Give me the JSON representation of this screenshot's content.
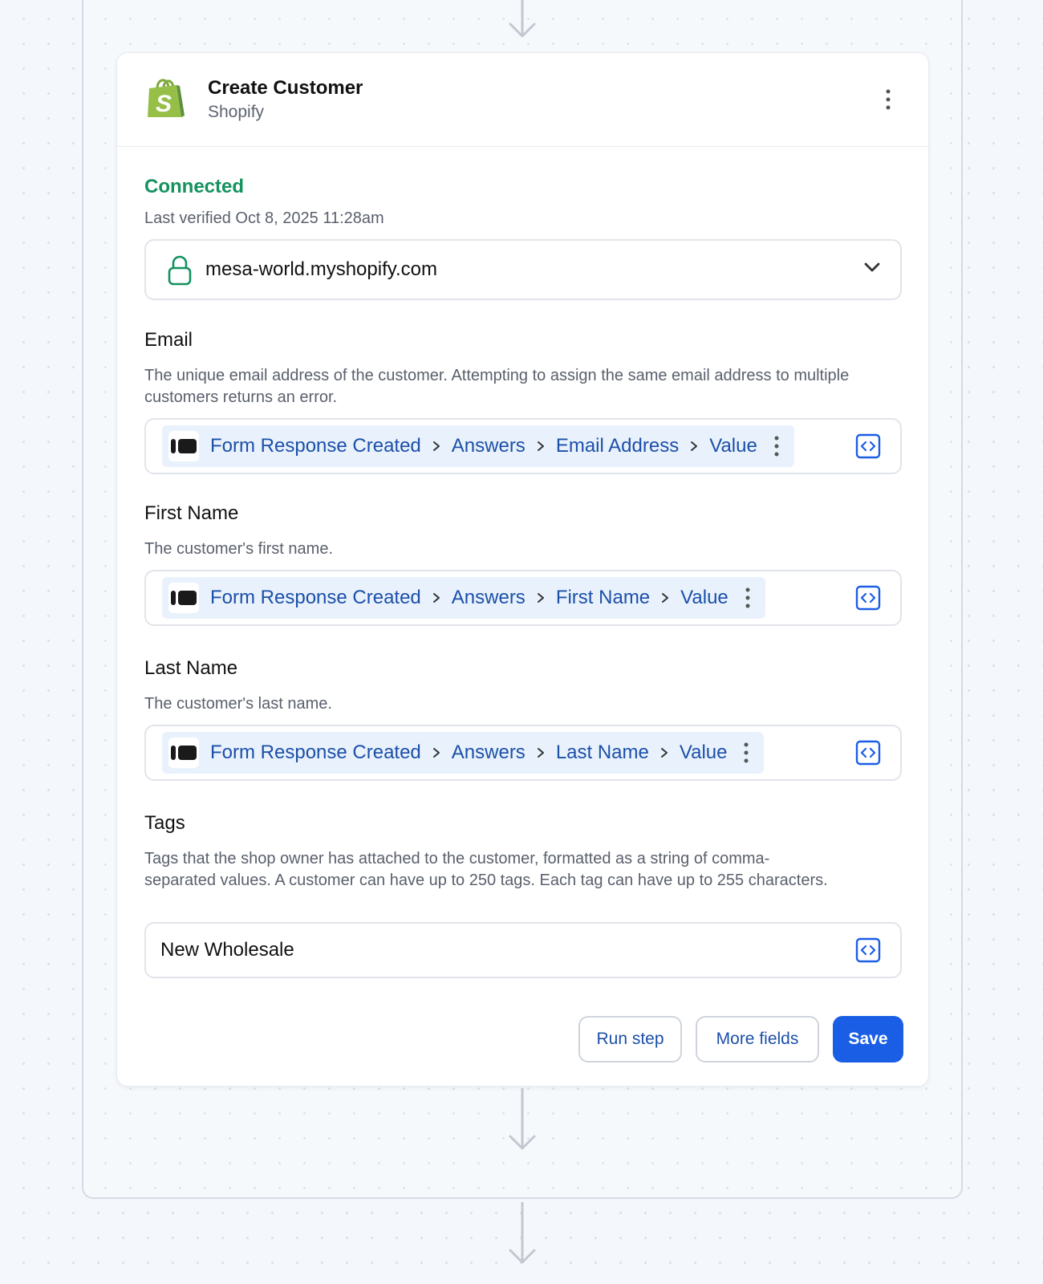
{
  "step": {
    "title": "Create Customer",
    "app": "Shopify",
    "logo_icon": "shopify-bag-icon",
    "brand_color": "#95bf47"
  },
  "connection": {
    "status": "Connected",
    "status_color": "#13925f",
    "last_verified": "Last verified Oct 8, 2025 11:28am",
    "account": "mesa-world.myshopify.com",
    "icons": [
      "lock-icon",
      "chevron-down-icon"
    ]
  },
  "fields": {
    "email": {
      "label": "Email",
      "description": "The unique email address of the customer. Attempting to assign the same email address to multiple customers returns an error.",
      "path": [
        "Form Response Created",
        "Answers",
        "Email Address",
        "Value"
      ]
    },
    "first_name": {
      "label": "First Name",
      "description": "The customer's first name.",
      "path": [
        "Form Response Created",
        "Answers",
        "First Name",
        "Value"
      ]
    },
    "last_name": {
      "label": "Last Name",
      "description": "The customer's last name.",
      "path": [
        "Form Response Created",
        "Answers",
        "Last Name",
        "Value"
      ]
    },
    "tags": {
      "label": "Tags",
      "description": "Tags that the shop owner has attached to the customer, formatted as a string of comma-separated values. A customer can have up to 250 tags. Each tag can have up to 255 characters.",
      "value": "New Wholesale"
    }
  },
  "actions": {
    "run_step": "Run step",
    "more_fields": "More fields",
    "save": "Save",
    "primary_color": "#1a5ee6"
  }
}
